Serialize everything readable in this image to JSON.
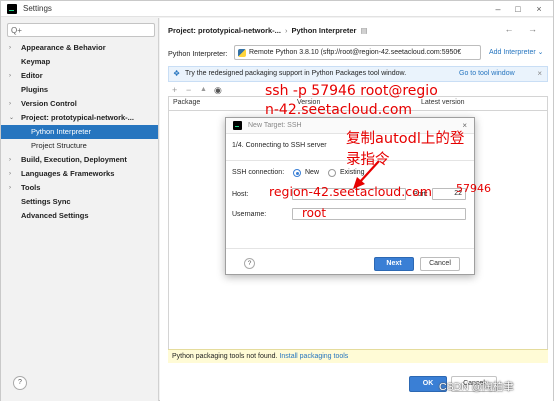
{
  "window": {
    "title": "Settings"
  },
  "sidebar": {
    "search_placeholder": "Q+",
    "items": [
      {
        "label": "Appearance & Behavior",
        "arrow": "›"
      },
      {
        "label": "Keymap",
        "arrow": ""
      },
      {
        "label": "Editor",
        "arrow": "›"
      },
      {
        "label": "Plugins",
        "arrow": ""
      },
      {
        "label": "Version Control",
        "arrow": "›"
      },
      {
        "label": "Project: prototypical-network-...",
        "arrow": "⌄"
      },
      {
        "label": "Python Interpreter",
        "arrow": ""
      },
      {
        "label": "Project Structure",
        "arrow": ""
      },
      {
        "label": "Build, Execution, Deployment",
        "arrow": "›"
      },
      {
        "label": "Languages & Frameworks",
        "arrow": "›"
      },
      {
        "label": "Tools",
        "arrow": "›"
      },
      {
        "label": "Settings Sync",
        "arrow": ""
      },
      {
        "label": "Advanced Settings",
        "arrow": ""
      }
    ],
    "help": "?"
  },
  "main": {
    "breadcrumb_project": "Project: prototypical-network-...",
    "breadcrumb_sep": "›",
    "breadcrumb_page": "Python Interpreter",
    "breadcrumb_icon": "▤",
    "nav_arrows": "← →",
    "interpreter_label": "Python Interpreter:",
    "interpreter_value": "Remote Python 3.8.10 (sftp://root@region-42.seetacloud.com:5950€",
    "add_interpreter": "Add Interpreter ⌄",
    "banner_text": "Try the redesigned packaging support in Python Packages tool window.",
    "banner_link": "Go to tool window",
    "banner_close": "×",
    "toolbar": {
      "add": "+",
      "remove": "−",
      "up": "▲",
      "eye": "◉"
    },
    "columns": {
      "package": "Package",
      "version": "Version",
      "latest": "Latest version"
    },
    "warning_text": "Python packaging tools not found.",
    "warning_link": "Install packaging tools"
  },
  "footer": {
    "ok": "OK",
    "cancel": "Cancel"
  },
  "watermark": "CSDN @陶柏聿",
  "dialog": {
    "title": "New Target: SSH",
    "close": "×",
    "step": "1/4. Connecting to SSH server",
    "ssh_connection_label": "SSH connection:",
    "option_new": "New",
    "option_existing": "Existing",
    "host_label": "Host:",
    "host_value": "",
    "port_label": "Port:",
    "port_value": "22",
    "username_label": "Username:",
    "username_value": "",
    "help": "?",
    "next": "Next",
    "cancel": "Cancel"
  },
  "annotations": {
    "ssh_line1": "ssh -p 57946 root@regio",
    "ssh_line2": "n-42.seetacloud.com",
    "cn_line1": "复制autodl上的登",
    "cn_line2": "录指令",
    "host": "region-42.seetacloud.com",
    "port": "57946",
    "username": "root",
    "color": "#e60000"
  },
  "colors": {
    "accent": "#2675bf",
    "selection": "#2675bf",
    "warning_bg": "#fffbd6"
  }
}
